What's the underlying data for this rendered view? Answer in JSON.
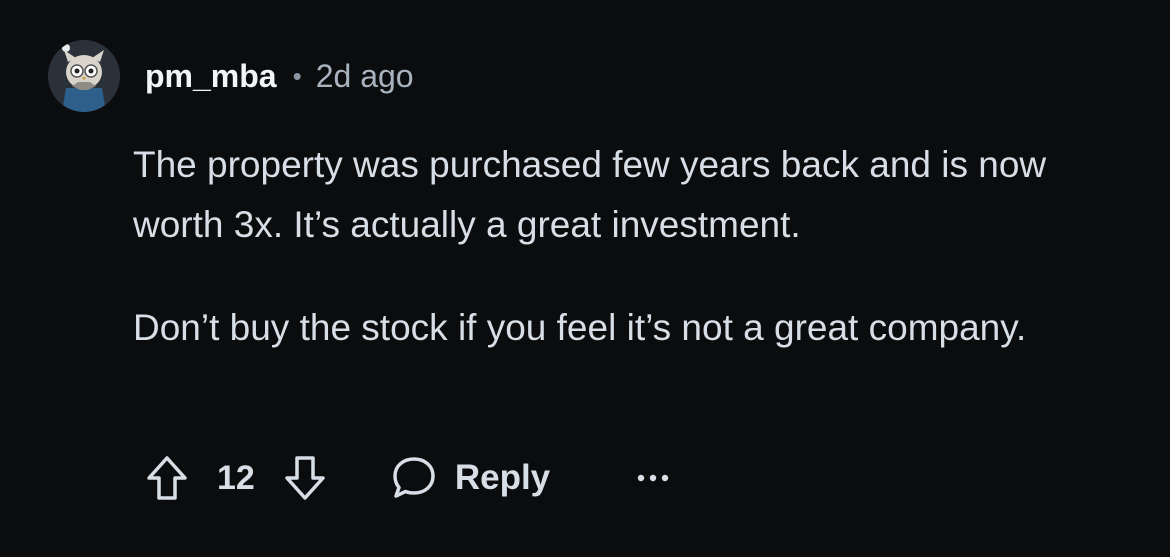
{
  "comment": {
    "username": "pm_mba",
    "separator": "•",
    "timestamp": "2d ago",
    "paragraphs": [
      "The property was purchased few years back and is now worth 3x. It’s actually a great investment.",
      "Don’t buy the stock if you feel it’s not a great company."
    ],
    "score": "12",
    "reply_label": "Reply"
  },
  "icons": {
    "avatar": "owl-avatar-icon",
    "upvote": "upvote-arrow-icon",
    "downvote": "downvote-arrow-icon",
    "reply": "speech-bubble-icon",
    "more": "more-dots-icon"
  },
  "colors": {
    "background": "#0b0c0e",
    "text": "#d7dee6",
    "muted": "#a8b3bf"
  }
}
